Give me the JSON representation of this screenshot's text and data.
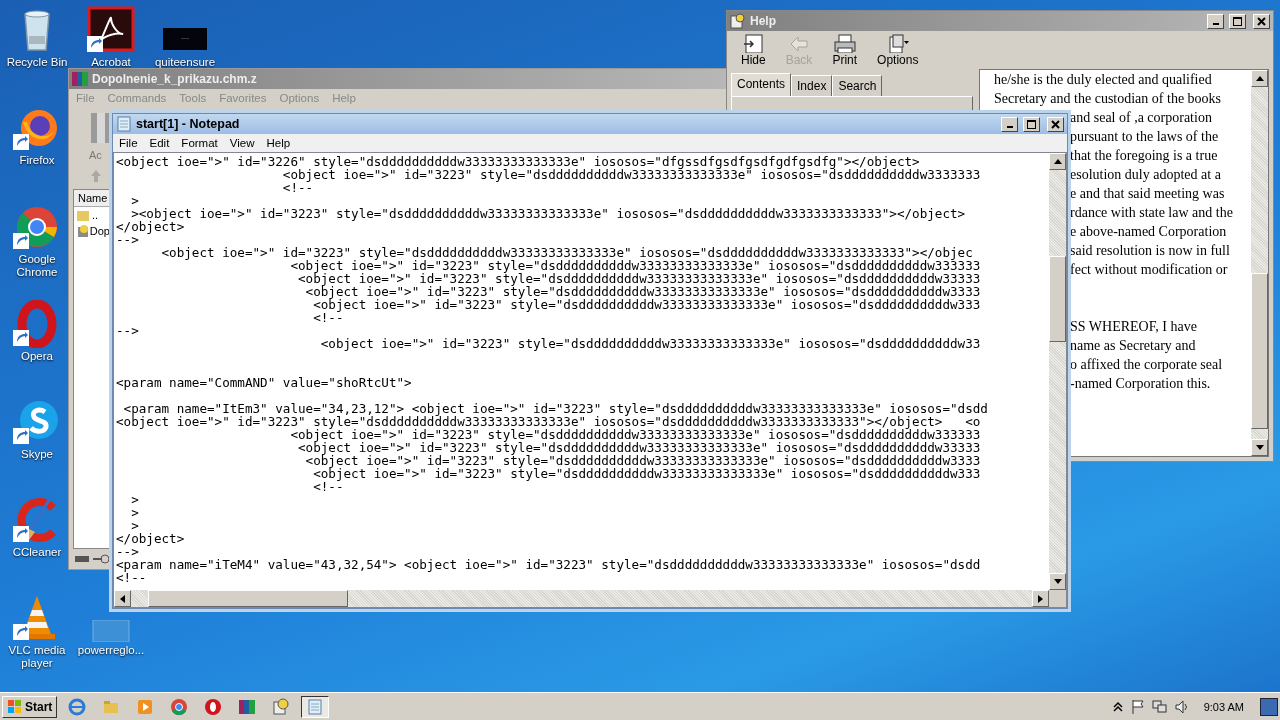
{
  "desktop_icons": [
    {
      "label": "Recycle Bin",
      "kind": "recycle",
      "shortcut": false
    },
    {
      "label": "Acrobat",
      "kind": "acrobat",
      "shortcut": true
    },
    {
      "label": "quiteensure",
      "kind": "dark",
      "shortcut": false
    },
    {
      "label": "Firefox",
      "kind": "firefox",
      "shortcut": true
    },
    {
      "label": "Google Chrome",
      "kind": "chrome",
      "shortcut": true
    },
    {
      "label": "Opera",
      "kind": "opera",
      "shortcut": true
    },
    {
      "label": "Skype",
      "kind": "skype",
      "shortcut": true
    },
    {
      "label": "CCleaner",
      "kind": "ccleaner",
      "shortcut": true
    },
    {
      "label": "VLC media player",
      "kind": "vlc",
      "shortcut": true
    },
    {
      "label": "powerreglo...",
      "kind": "blank",
      "shortcut": false
    }
  ],
  "archive_window": {
    "title": "Dopolnenie_k_prikazu.chm.z",
    "menu": [
      "File",
      "Commands",
      "Tools",
      "Favorites",
      "Options",
      "Help"
    ],
    "toolbar_label": "Ac",
    "column": "Name",
    "rows": [
      {
        "name": "..",
        "kind": "folder"
      },
      {
        "name": "Dop",
        "kind": "help"
      }
    ]
  },
  "help_window": {
    "title": "Help",
    "toolbar": [
      {
        "label": "Hide",
        "kind": "hide",
        "disabled": false
      },
      {
        "label": "Back",
        "kind": "back",
        "disabled": true
      },
      {
        "label": "Print",
        "kind": "print",
        "disabled": false
      },
      {
        "label": "Options",
        "kind": "options",
        "disabled": false
      }
    ],
    "tabs": [
      {
        "label": "Contents",
        "selected": true
      },
      {
        "label": "Index",
        "selected": false
      },
      {
        "label": "Search",
        "selected": false
      }
    ],
    "paragraphs": [
      [
        {
          "text": "he/she is the duly elected and qualified",
          "covered": false
        },
        {
          "text": "Secretary and the custodian of the books",
          "covered": false
        },
        {
          "text": "and seal of ,a corporation",
          "covered": true
        },
        {
          "text": "pursuant to the laws of the",
          "covered": true
        },
        {
          "text": "that the foregoing is a true",
          "covered": true
        },
        {
          "text": "esolution duly adopted at a",
          "covered": true
        },
        {
          "text": "e and that said meeting was",
          "covered": true
        },
        {
          "text": "rdance with state law and the",
          "covered": true
        },
        {
          "text": "e above-named Corporation",
          "covered": true
        },
        {
          "text": "said resolution is now in full",
          "covered": true
        },
        {
          "text": "fect without modification or",
          "covered": true
        }
      ],
      [
        {
          "text": "SS WHEREOF, I have",
          "covered": true
        },
        {
          "text": "name as Secretary and",
          "covered": true
        },
        {
          "text": "o affixed the corporate seal",
          "covered": true
        },
        {
          "text": "-named Corporation this.",
          "covered": true
        }
      ]
    ]
  },
  "notepad": {
    "title": "start[1] - Notepad",
    "menu": [
      "File",
      "Edit",
      "Format",
      "View",
      "Help"
    ],
    "text": "<object ioe=\">\" id=\"3226\" style=\"dsddddddddddw33333333333333e\" iososos=\"dfgssdfgsdfgsdfgdfgsdfg\"></object>\n                      <object ioe=\">\" id=\"3223\" style=\"dsddddddddddw33333333333333e\" iososos=\"dsddddddddddw3333333\n                      <!--\n  >\n  ><object ioe=\">\" id=\"3223\" style=\"dsddddddddddw33333333333333e\" iososos=\"dsddddddddddw3333333333333\"></object>\n</object>\n-->\n      <object ioe=\">\" id=\"3223\" style=\"dsddddddddddw33333333333333e\" iososos=\"dsddddddddddw3333333333333\"></objec\n                       <object ioe=\">\" id=\"3223\" style=\"dsddddddddddw33333333333333e\" iososos=\"dsddddddddddw333333\n                        <object ioe=\">\" id=\"3223\" style=\"dsddddddddddw33333333333333e\" iososos=\"dsddddddddddw33333\n                         <object ioe=\">\" id=\"3223\" style=\"dsddddddddddw33333333333333e\" iososos=\"dsddddddddddw3333\n                          <object ioe=\">\" id=\"3223\" style=\"dsddddddddddw33333333333333e\" iososos=\"dsddddddddddw333\n                          <!--\n-->\n                           <object ioe=\">\" id=\"3223\" style=\"dsddddddddddw33333333333333e\" iososos=\"dsddddddddddw33\n\n\n<param name=\"CommAND\" value=\"shoRtcUt\">\n\n <param name=\"ItEm3\" value=\"34,23,12\"> <object ioe=\">\" id=\"3223\" style=\"dsddddddddddw33333333333333e\" iososos=\"dsdd\n<object ioe=\">\" id=\"3223\" style=\"dsddddddddddw33333333333333e\" iososos=\"dsddddddddddw3333333333333\"></object>   <o\n                       <object ioe=\">\" id=\"3223\" style=\"dsddddddddddw33333333333333e\" iososos=\"dsddddddddddw333333\n                        <object ioe=\">\" id=\"3223\" style=\"dsddddddddddw33333333333333e\" iososos=\"dsddddddddddw33333\n                         <object ioe=\">\" id=\"3223\" style=\"dsddddddddddw33333333333333e\" iososos=\"dsddddddddddw3333\n                          <object ioe=\">\" id=\"3223\" style=\"dsddddddddddw33333333333333e\" iososos=\"dsddddddddddw333\n                          <!--\n  >\n  >\n  >\n</object>\n-->\n<param name=\"iTeM4\" value=\"43,32,54\"> <object ioe=\">\" id=\"3223\" style=\"dsddddddddddw33333333333333e\" iososos=\"dsdd\n<!--"
  },
  "taskbar": {
    "start": "Start",
    "apps": [
      {
        "kind": "ie",
        "active": false
      },
      {
        "kind": "explorer",
        "active": false
      },
      {
        "kind": "media",
        "active": false
      },
      {
        "kind": "chrome",
        "active": false
      },
      {
        "kind": "opera",
        "active": false
      },
      {
        "kind": "winrar",
        "active": false
      },
      {
        "kind": "help",
        "active": false
      },
      {
        "kind": "notepad",
        "active": true
      }
    ],
    "clock": "9:03 AM"
  }
}
